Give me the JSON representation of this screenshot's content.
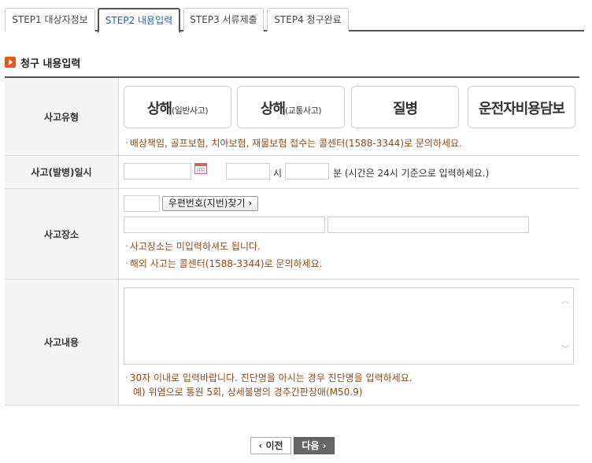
{
  "tabs": [
    {
      "label": "STEP1 대상자정보",
      "active": false
    },
    {
      "label": "STEP2 내용입력",
      "active": true
    },
    {
      "label": "STEP3 서류제출",
      "active": false
    },
    {
      "label": "STEP4 청구완료",
      "active": false
    }
  ],
  "section_title": "청구 내용입력",
  "form": {
    "accident_type": {
      "label": "사고유형",
      "options": [
        {
          "big": "상해",
          "small": "(일반사고)"
        },
        {
          "big": "상해",
          "small": "(교통사고)"
        },
        {
          "big": "질병",
          "small": ""
        },
        {
          "big": "운전자비용담보",
          "small": ""
        }
      ],
      "note": "배상책임, 골프보험, 치아보험, 재물보험 접수는 콜센터(1588-3344)로 문의하세요."
    },
    "accident_date": {
      "label": "사고(발병)일시",
      "date_value": "",
      "hour_value": "",
      "hour_unit": "시",
      "minute_value": "",
      "minute_unit": "분 (시간은 24시 기준으로 입력하세요.)"
    },
    "accident_place": {
      "label": "사고장소",
      "zip_value": "",
      "zip_button": "우편번호(지번)찾기 ›",
      "address1_value": "",
      "address2_value": "",
      "notes": [
        "사고장소는 미입력하셔도 됩니다.",
        "해외 사고는 콜센터(1588-3344)로 문의하세요."
      ]
    },
    "accident_content": {
      "label": "사고내용",
      "value": "",
      "note_line1": "30자 이내로 입력바랍니다. 진단명을 아시는 경우 진단명을 입력하세요.",
      "note_line2": "예) 위염으로 통원 5회, 상세불명의 경추간판장애(M50.9)"
    }
  },
  "buttons": {
    "prev": "‹ 이전",
    "next": "다음 ›"
  },
  "colors": {
    "accent_orange": "#e15a1f",
    "note_brown": "#8a4b1a",
    "active_tab_text": "#2a5fa0"
  }
}
